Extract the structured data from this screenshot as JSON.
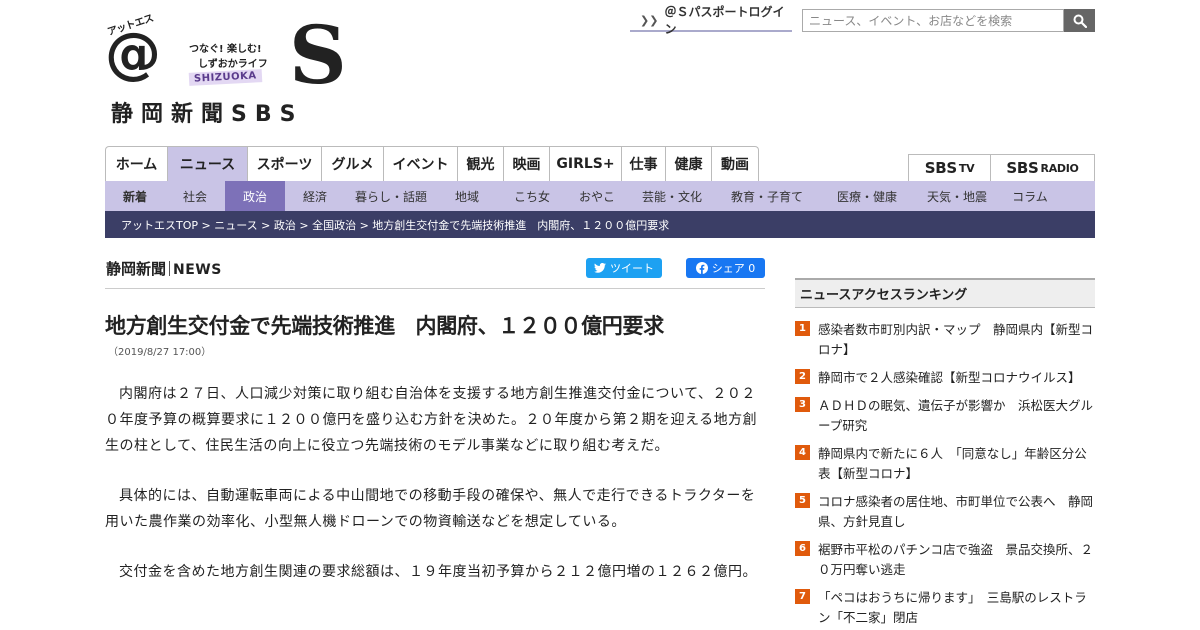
{
  "header": {
    "logo": {
      "small_kana": "アットエス",
      "at": "@",
      "catch_line1": "つなぐ! 楽しむ!",
      "catch_line2": "しずおかライフ",
      "shizuoka": "SHIZUOKA",
      "big_s": "S",
      "paper_name": "静岡新聞SBS"
    },
    "login_label": "＠Ｓパスポートログイン",
    "search": {
      "placeholder": "ニュース、イベント、お店などを検索"
    }
  },
  "main_nav": {
    "items": [
      {
        "label": "ホーム"
      },
      {
        "label": "ニュース"
      },
      {
        "label": "スポーツ"
      },
      {
        "label": "グルメ"
      },
      {
        "label": "イベント"
      },
      {
        "label": "観光"
      },
      {
        "label": "映画"
      },
      {
        "label": "GIRLS+"
      },
      {
        "label": "仕事"
      },
      {
        "label": "健康"
      },
      {
        "label": "動画"
      }
    ],
    "active": "ニュース"
  },
  "broadcast": {
    "tv_main": "SBS",
    "tv_sub": "TV",
    "radio_main": "SBS",
    "radio_sub": "RADIO"
  },
  "sub_nav": {
    "items": [
      {
        "label": "新着"
      },
      {
        "label": "社会"
      },
      {
        "label": "政治"
      },
      {
        "label": "経済"
      },
      {
        "label": "暮らし・話題"
      },
      {
        "label": "地域"
      },
      {
        "label": "こち女"
      },
      {
        "label": "おやこ"
      },
      {
        "label": "芸能・文化"
      },
      {
        "label": "教育・子育て"
      },
      {
        "label": "医療・健康"
      },
      {
        "label": "天気・地震"
      },
      {
        "label": "コラム"
      }
    ],
    "active": "政治"
  },
  "breadcrumb": "アットエスTOP > ニュース > 政治 > 全国政治 > 地方創生交付金で先端技術推進　内閣府、１２００億円要求",
  "article": {
    "source_ja": "静岡新聞",
    "source_en": "NEWS",
    "tweet_label": "ツイート",
    "share_label": "シェア 0",
    "headline": "地方創生交付金で先端技術推進　内閣府、１２００億円要求",
    "date": "（2019/8/27 17:00）",
    "paragraphs": [
      "内閣府は２７日、人口減少対策に取り組む自治体を支援する地方創生推進交付金について、２０２０年度予算の概算要求に１２００億円を盛り込む方針を決めた。２０年度から第２期を迎える地方創生の柱として、住民生活の向上に役立つ先端技術のモデル事業などに取り組む考えだ。",
      "具体的には、自動運転車両による中山間地での移動手段の確保や、無人で走行できるトラクターを用いた農作業の効率化、小型無人機ドローンでの物資輸送などを想定している。",
      "交付金を含めた地方創生関連の要求総額は、１９年度当初予算から２１２億円増の１２６２億円。"
    ]
  },
  "sidebar": {
    "ranking_title": "ニュースアクセスランキング",
    "ranking": [
      {
        "rank": "1",
        "title": "感染者数市町別内訳・マップ　静岡県内【新型コロナ】"
      },
      {
        "rank": "2",
        "title": "静岡市で２人感染確認【新型コロナウイルス】"
      },
      {
        "rank": "3",
        "title": "ＡＤＨＤの眠気、遺伝子が影響か　浜松医大グループ研究"
      },
      {
        "rank": "4",
        "title": "静岡県内で新たに６人　「同意なし」年齢区分公表【新型コロナ】"
      },
      {
        "rank": "5",
        "title": "コロナ感染者の居住地、市町単位で公表へ　静岡県、方針見直し"
      },
      {
        "rank": "6",
        "title": "裾野市平松のパチンコ店で強盗　景品交換所、２０万円奪い逃走"
      },
      {
        "rank": "7",
        "title": "「ペコはおうちに帰ります」　三島駅のレストラン「不二家」閉店"
      }
    ]
  },
  "colors": {
    "nav_active": "#c9c4e6",
    "subnav_bg": "#c9c4e6",
    "subnav_active": "#7d71b8",
    "breadcrumb_bg": "#3b3e66",
    "rank_badge": "#e05a0c",
    "twitter": "#1da1f2",
    "facebook": "#1877f2"
  },
  "icons": {
    "search": "search-icon",
    "twitter": "twitter-bird-icon",
    "facebook": "facebook-icon",
    "chevron": "double-chevron-icon"
  }
}
